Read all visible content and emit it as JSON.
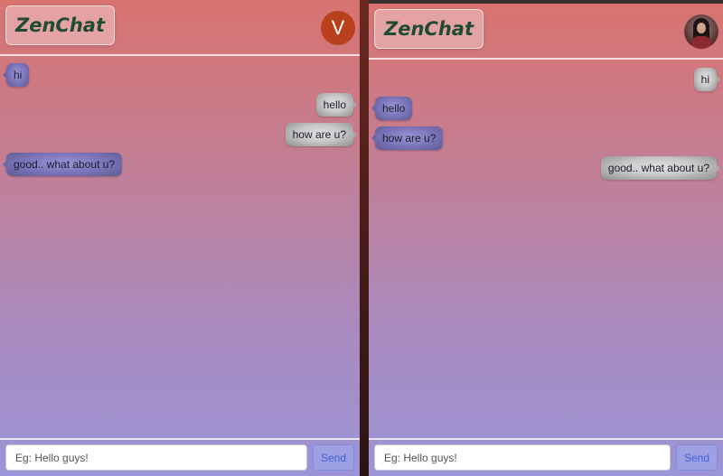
{
  "app": {
    "logo": "ZenChat"
  },
  "left": {
    "avatar_letter": "V",
    "messages": [
      {
        "text": "hi",
        "dir": "in"
      },
      {
        "text": "hello",
        "dir": "out"
      },
      {
        "text": "how are u?",
        "dir": "out"
      },
      {
        "text": "good.. what about u?",
        "dir": "in"
      }
    ],
    "input_placeholder": "Eg: Hello guys!",
    "send_label": "Send"
  },
  "right": {
    "avatar_icon": "user-photo-avatar",
    "messages": [
      {
        "text": "hi",
        "dir": "out"
      },
      {
        "text": "hello",
        "dir": "in"
      },
      {
        "text": "how are u?",
        "dir": "in"
      },
      {
        "text": "good.. what about u?",
        "dir": "out"
      }
    ],
    "input_placeholder": "Eg: Hello guys!",
    "send_label": "Send"
  },
  "colors": {
    "logo_text": "#1f4a34",
    "avatar_bg": "#b8401c",
    "send_text": "#3b63d6",
    "gradient_top": "#d97370",
    "gradient_bottom": "#9b94d6"
  }
}
